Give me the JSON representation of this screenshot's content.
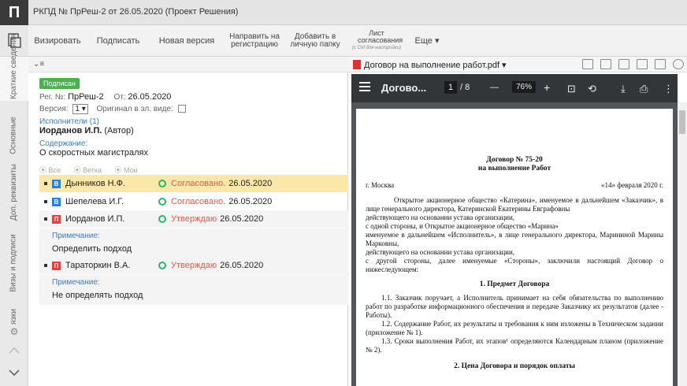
{
  "app": {
    "logo": "П",
    "title": "РКПД № ПрРеш-2 от 26.05.2020 (Проект Решения)"
  },
  "toolbar": {
    "buttons": [
      "Визировать",
      "Подписать",
      "Новая версия",
      "Направить на регистрацию",
      "Добавить в личную папку",
      "Лист согласования",
      "Еще ▾"
    ],
    "hint": "(с Ctrl для настройки)"
  },
  "leftnav": {
    "tabs": [
      "Краткие сведения",
      "Основные",
      "Доп. реквизиты",
      "Визы и подписи",
      "язки"
    ]
  },
  "card": {
    "status_badge": "Подписан",
    "reg_label": "Рег. №:",
    "reg_value": "ПрРеш-2",
    "date_label": "От:",
    "date_value": "26.05.2020",
    "version_label": "Версия:",
    "version_value": "1 ▾",
    "original_label": "Оригинал в эл. виде:",
    "executors_label": "Исполнители (1)",
    "executor": "Иорданов И.П.",
    "executor_role": "(Автор)",
    "content_label": "Содержание:",
    "content_value": "О скоростных магистралях",
    "filters": [
      "⦿ Все",
      "⦿ Ветка",
      "⦿ Мои"
    ]
  },
  "visas": [
    {
      "letter": "В",
      "name": "Дынников Н.Ф.",
      "status": "Согласовано.",
      "date": "26.05.2020"
    },
    {
      "letter": "В",
      "name": "Шепелева И.Г.",
      "status": "Согласовано.",
      "date": "26.05.2020"
    },
    {
      "letter": "П",
      "name": "Иорданов И.П.",
      "status": "Утверждаю",
      "date": "26.05.2020",
      "note_label": "Примечание:",
      "note": "Определить подход"
    },
    {
      "letter": "П",
      "name": "Тараторкин В.А.",
      "status": "Утверждаю",
      "date": "26.05.2020",
      "note_label": "Примечание:",
      "note": "Не определять подход"
    }
  ],
  "viewer": {
    "file": "Договор на выполнение работ.pdf ▾",
    "title": "Догово...",
    "page": "1",
    "pages": "/ 8",
    "zoom": "76%",
    "icons": [
      "menu-icon",
      "rotate-icon",
      "download-icon",
      "print-icon",
      "more-icon"
    ]
  },
  "doc": {
    "h1": "Договор № 75-20",
    "h2": "на выполнение Работ",
    "city": "г. Москва",
    "date": "«14» февраля 2020 г.",
    "p1": "Открытое акционерное общество «Катерина», именуемое в дальнейшем «Заказчик», в лице генерального директора, Катеринской Екатерины Евграфовны",
    "p2": "действующего на основании устава организации,",
    "p3": "с одной стороны, и Открытое акционерное общество «Марина»",
    "p4": "именуемое в дальнейшем «Исполнитель», в лице генерального директора, Марининой Марины Марковны,",
    "p5": "действующего на основании устава организации,",
    "p6": "с другой стороны, далее именуемые «Стороны», заключили настоящий Договор о нижеследующем:",
    "s1": "1. Предмет Договора",
    "p7": "1.1. Заказчик поручает, а Исполнитель принимает на себя обязательства по выполнению работ по разработке информационного обеспечения и передаче Заказчику их результатов (далее - Работы).",
    "p8": "1.2. Содержание Работ, их результаты и требования к ним изложены в Техническом задании (приложение № 1).",
    "p9": "1.3. Сроки выполнения Работ, их этапов¹ определяются Календарным планом (приложение № 2).",
    "s2": "2. Цена Договора и порядок оплаты"
  },
  "colors": {
    "accent": "#3b7bbf",
    "status_red": "#e35b4f",
    "badge_green": "#4caf50",
    "highlight": "#fbe7a8"
  }
}
